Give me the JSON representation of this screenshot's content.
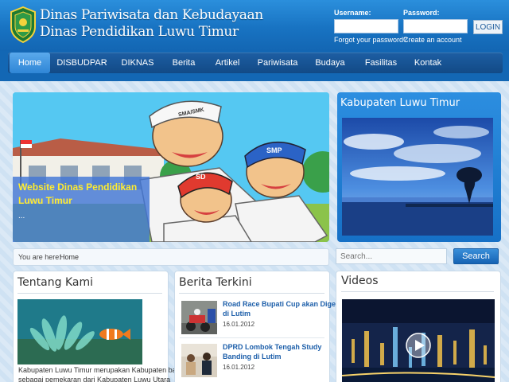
{
  "header": {
    "title_line1": "Dinas Pariwisata dan Kebudayaan",
    "title_line2": "Dinas Pendidikan Luwu Timur",
    "logo_icon": "regency-shield-emblem-icon"
  },
  "login": {
    "username_label": "Username:",
    "password_label": "Password:",
    "username_value": "",
    "password_value": "",
    "forgot_password": "Forgot your password?",
    "create_account": "Create an account",
    "login_button": "LOGIN"
  },
  "nav": {
    "items": [
      {
        "label": "Home",
        "active": true
      },
      {
        "label": "DISBUDPAR"
      },
      {
        "label": "DIKNAS"
      },
      {
        "label": "Berita"
      },
      {
        "label": "Artikel"
      },
      {
        "label": "Pariwisata"
      },
      {
        "label": "Budaya"
      },
      {
        "label": "Fasilitas"
      },
      {
        "label": "Kontak"
      }
    ]
  },
  "slider": {
    "caption_line1": "Website Dinas Pendidikan",
    "caption_line2": "Luwu Timur",
    "caption_more": "...",
    "hat_labels": [
      "SMA/SMK",
      "SMP",
      "SD"
    ]
  },
  "kabupaten": {
    "title": "Kabupaten Luwu Timur"
  },
  "breadcrumb": {
    "prefix": "You are here:",
    "current": "Home"
  },
  "search": {
    "placeholder": "Search...",
    "button": "Search"
  },
  "tentang": {
    "title": "Tentang Kami",
    "text_line1": "Kabupaten Luwu Timur merupakan Kabupaten baru",
    "text_line2": "sebagai pemekaran dari Kabupaten Luwu Utara"
  },
  "berita": {
    "title": "Berita Terkini",
    "items": [
      {
        "title_line1": "Road Race Bupati Cup akan Digelar",
        "title_line2": "di Lutim",
        "date": "16.01.2012"
      },
      {
        "title_line1": "DPRD Lombok Tengah Study",
        "title_line2": "Banding di Lutim",
        "date": "16.01.2012"
      }
    ]
  },
  "videos": {
    "title": "Videos",
    "play_icon": "play-icon"
  },
  "colors": {
    "header_blue": "#1873c2",
    "nav_dark": "#124a86",
    "nav_active": "#3a8fd9",
    "caption_yellow": "#ffec2e",
    "link_blue": "#1d5faa"
  }
}
